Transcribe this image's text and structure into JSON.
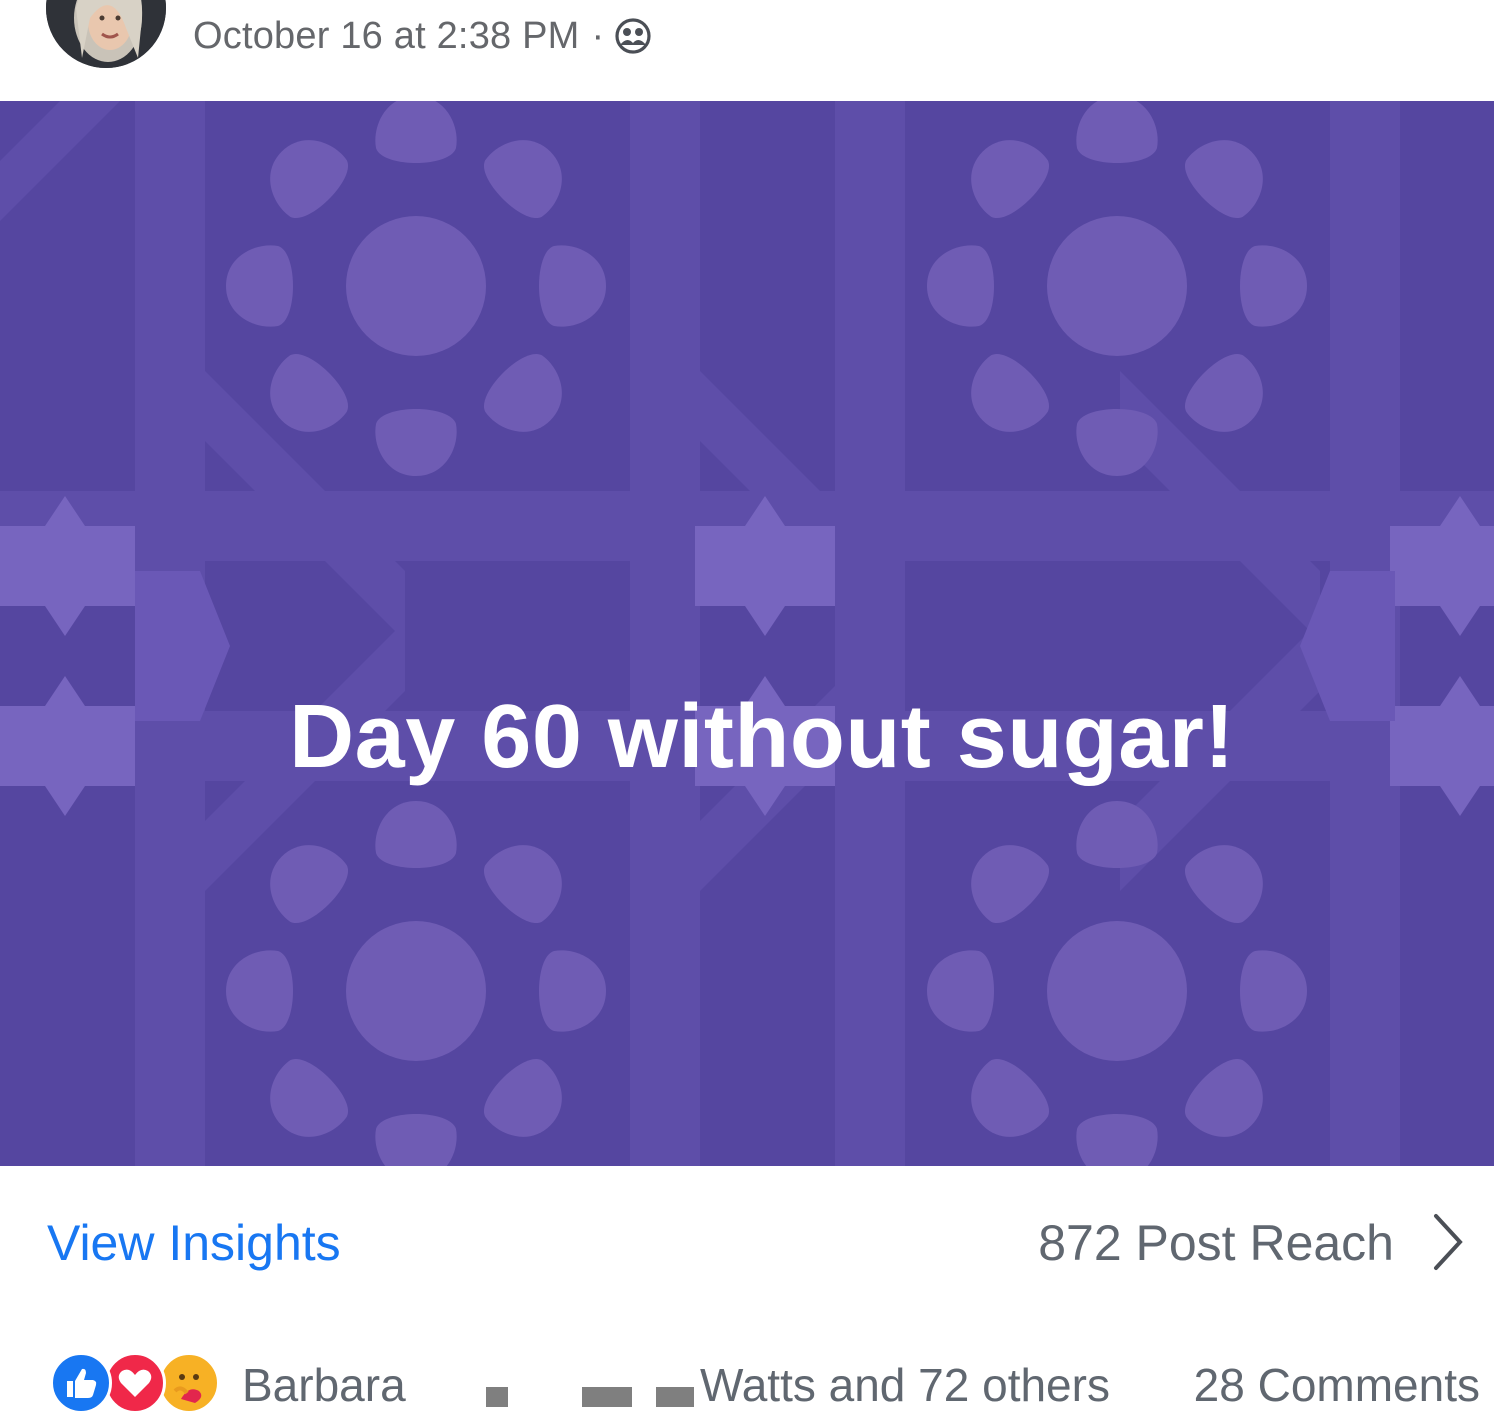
{
  "post": {
    "timestamp": "October 16 at 2:38 PM",
    "separator": "·",
    "privacy_icon": "friends-icon",
    "menu_icon": "more-icon",
    "content_text": "Day 60 without sugar!",
    "background_color": "#5546a0",
    "pattern_color": "#6f5cb4"
  },
  "insights": {
    "view_label": "View Insights",
    "reach_label": "872 Post Reach",
    "chevron_icon": "chevron-right-icon",
    "link_color": "#1877f2"
  },
  "reactions": {
    "icons": [
      "like-icon",
      "love-icon",
      "care-icon"
    ],
    "first_name": "Barbara",
    "rest_text": "Watts and 72 others",
    "comments_label": "28 Comments"
  }
}
